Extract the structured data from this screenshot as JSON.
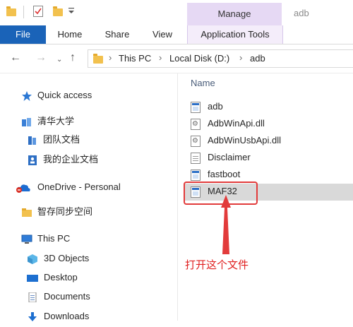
{
  "window": {
    "contextual_tab": "Manage",
    "title": "adb"
  },
  "ribbon": {
    "tabs": [
      "File",
      "Home",
      "Share",
      "View",
      "Application Tools"
    ]
  },
  "address": {
    "crumbs": [
      "This PC",
      "Local Disk (D:)",
      "adb"
    ]
  },
  "nav": {
    "quick_access": "Quick access",
    "tsinghua": "清华大学",
    "team_docs": "团队文档",
    "my_enterprise_docs": "我的企业文档",
    "onedrive": "OneDrive - Personal",
    "sync_space": "智存同步空间",
    "this_pc": "This PC",
    "objects_3d": "3D Objects",
    "desktop": "Desktop",
    "documents": "Documents",
    "downloads": "Downloads"
  },
  "list": {
    "column_name": "Name",
    "files": [
      {
        "name": "adb",
        "icon": "exe-icon"
      },
      {
        "name": "AdbWinApi.dll",
        "icon": "dll-icon"
      },
      {
        "name": "AdbWinUsbApi.dll",
        "icon": "dll-icon"
      },
      {
        "name": "Disclaimer",
        "icon": "document-icon"
      },
      {
        "name": "fastboot",
        "icon": "exe-icon"
      },
      {
        "name": "MAF32",
        "icon": "exe-icon",
        "selected": true
      }
    ]
  },
  "annotation": {
    "text": "打开这个文件",
    "color": "#e02020"
  },
  "colors": {
    "file_tab": "#1a63b8",
    "manage_tab": "#e6d9f4",
    "selected_row": "#d9d9d9",
    "annotation_red": "#e23b3b"
  }
}
